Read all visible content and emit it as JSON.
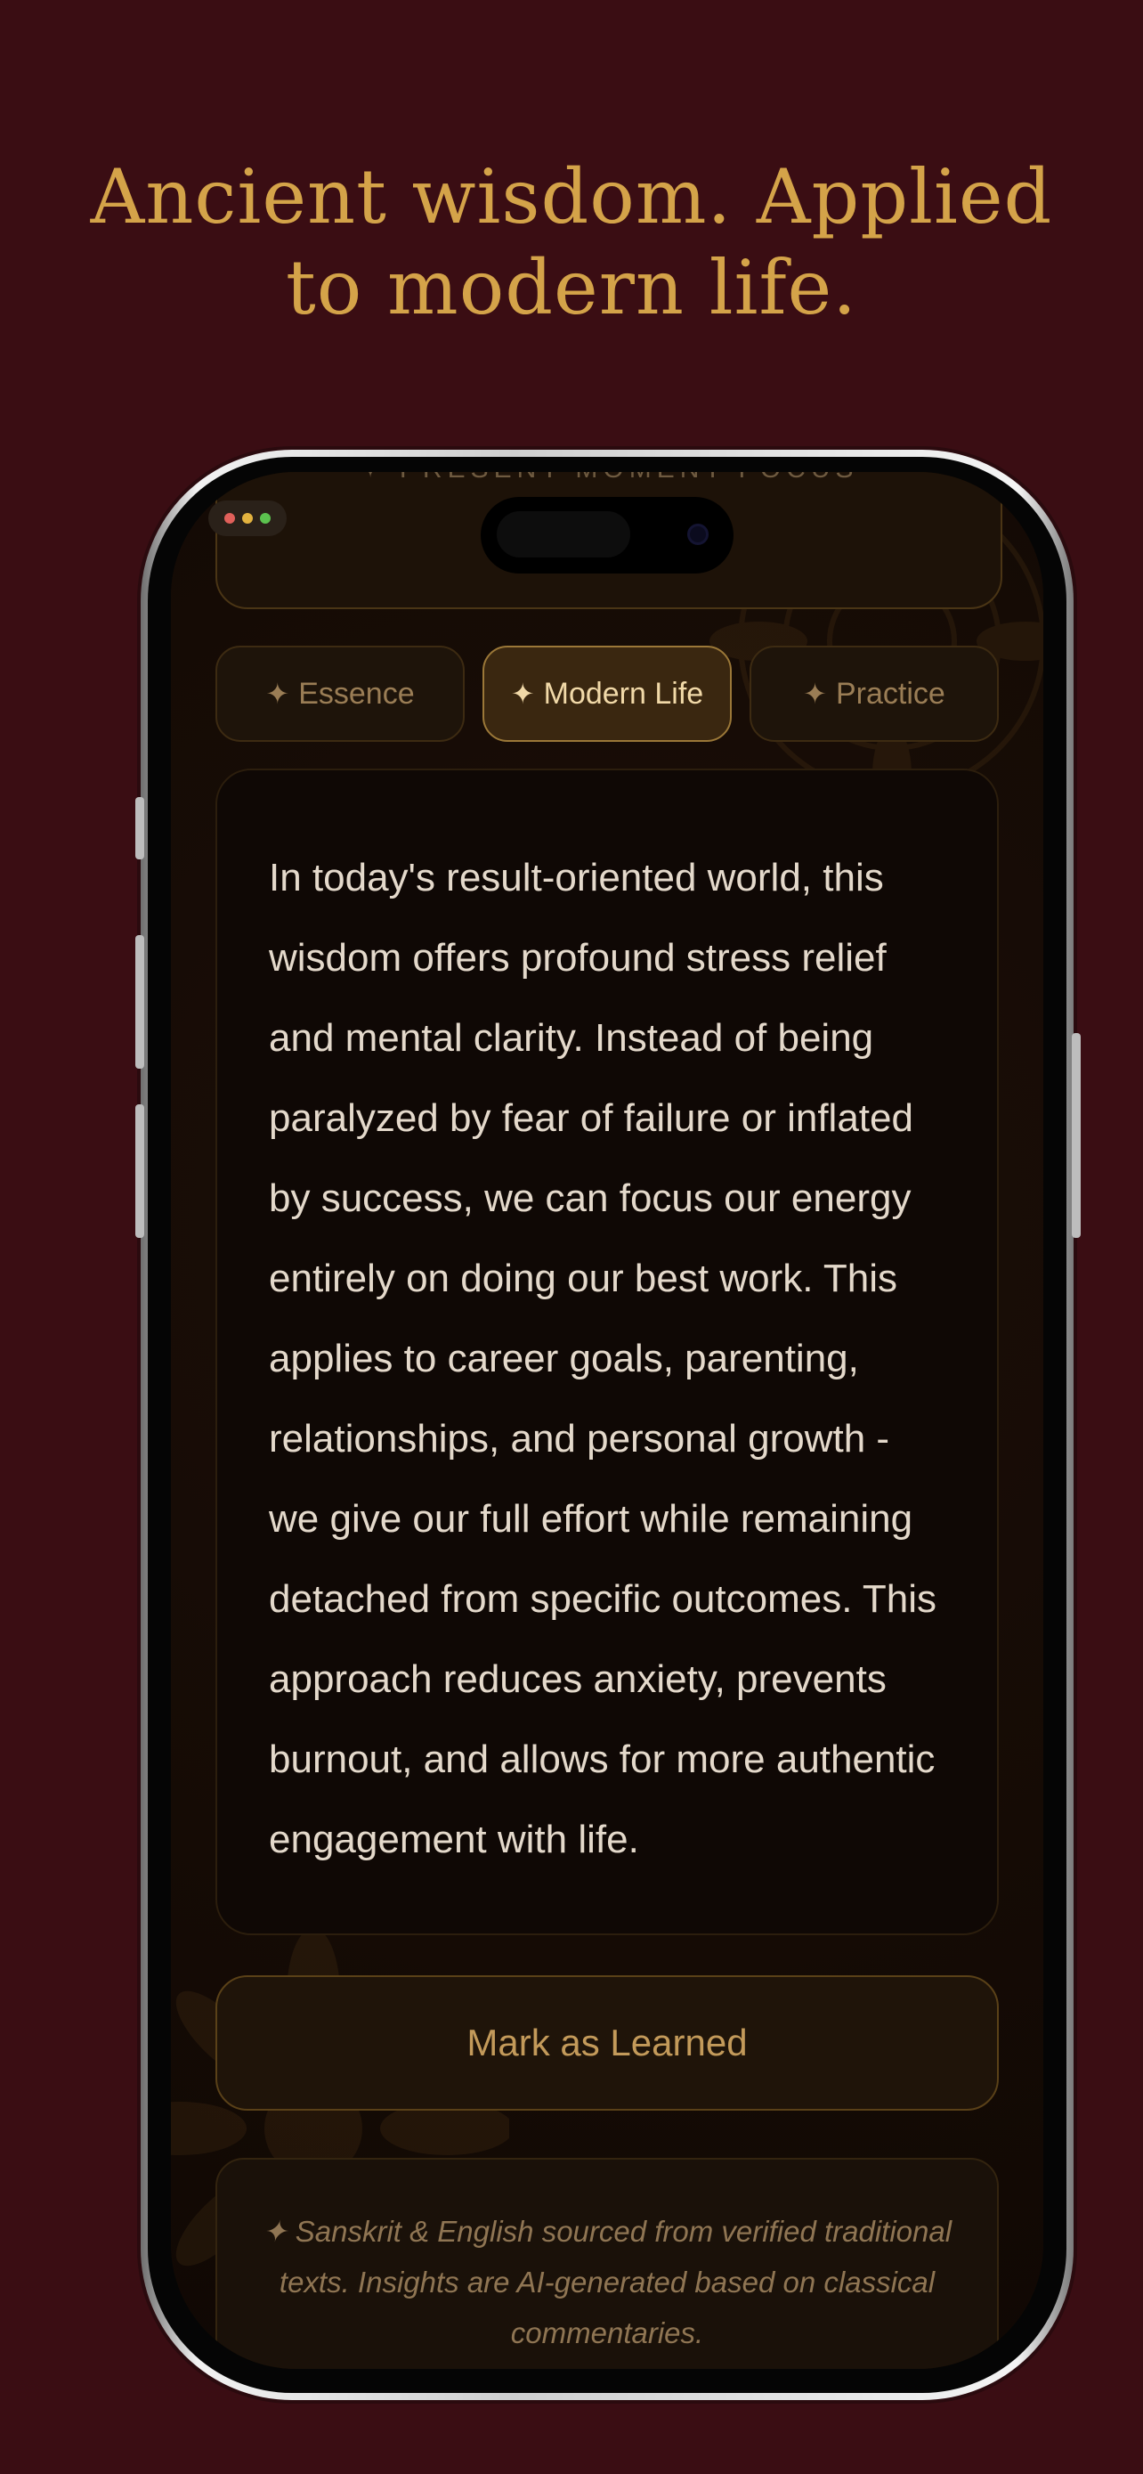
{
  "headline": {
    "line1": "Ancient wisdom. Applied",
    "line2": "to modern life."
  },
  "screen": {
    "top_card_label": "✦ PRESENT MOMENT FOCUS",
    "tabs": [
      {
        "star": "✦",
        "label": "Essence",
        "active": false
      },
      {
        "star": "✦",
        "label": "Modern Life",
        "active": true
      },
      {
        "star": "✦",
        "label": "Practice",
        "active": false
      }
    ],
    "content": "In today's result-oriented world, this wisdom offers profound stress relief and mental clarity. Instead of being paralyzed by fear of failure or inflated by success, we can focus our energy entirely on doing our best work. This applies to career goals, parenting, relationships, and personal growth - we give our full effort while remaining detached from specific outcomes. This approach reduces anxiety, prevents burnout, and allows for more authentic engagement with life.",
    "learn_button": "Mark as Learned",
    "footer_note": "✦ Sanskrit & English sourced from verified traditional texts. Insights are AI-generated based on classical commentaries."
  },
  "colors": {
    "background": "#3a0d13",
    "headline": "#d4a349",
    "accent": "#9b7838",
    "screen_bg": "#150b05"
  },
  "icons": [
    "star-icon",
    "mandala-decoration"
  ]
}
